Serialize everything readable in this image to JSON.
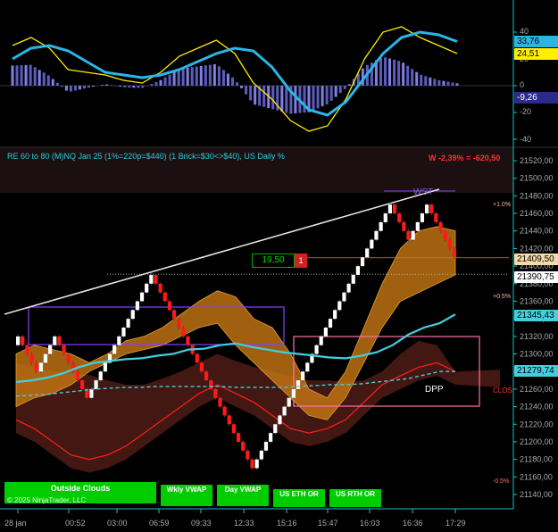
{
  "oscillator": {
    "tick_labels": [
      "40",
      "20",
      "0",
      "-20",
      "-40"
    ],
    "tag_blue": "33,76",
    "tag_yellow": "24,51",
    "tag_purple": "-9,26",
    "colors": {
      "fast": "#ffee00",
      "slow": "#29b6e6",
      "histogram": "#5c5cc0",
      "histogram_highlight": "#8080e0"
    }
  },
  "header": {
    "title": "RE 60 to 80 (M)NQ Jan 25 (1%=220p=$440) (1 Brick=$30<>$40), US Daily %",
    "pnl": "W -2,39% = -620,50"
  },
  "price_axis": {
    "ticks": [
      "21520,00",
      "21500,00",
      "21480,00",
      "21460,00",
      "21440,00",
      "21420,00",
      "21400,00",
      "21380,00",
      "21360,00",
      "21340,00",
      "21320,00",
      "21300,00",
      "21280,00",
      "21260,00",
      "21240,00",
      "21220,00",
      "21200,00",
      "21180,00",
      "21160,00",
      "21140,00"
    ],
    "tags": {
      "last_price": "21409,50",
      "dotted_level": "21390,75",
      "cyan_vwap": "21345,43",
      "cyan_dashed": "21279,74"
    }
  },
  "time_axis": [
    "28 jan",
    "00:52",
    "03:00",
    "06:59",
    "09:33",
    "12:33",
    "15:16",
    "15:47",
    "16:03",
    "16:36",
    "17:29"
  ],
  "annotations": {
    "wst": "WST",
    "dpp": "DPP",
    "pct_plus1": "+1.0%",
    "pct_plus05": "+0.5%",
    "pct_minus05": "-0.5%",
    "clos": "CLOS",
    "position_value": "19,50",
    "position_qty": "1"
  },
  "buttons": {
    "outside_clouds": "Outside Clouds",
    "wkly_vwap": "Wkly VWAP",
    "day_vwap": "Day VWAP",
    "us_eth_or": "US ETH OR",
    "us_rth_or": "US RTH OR"
  },
  "copyright": "© 2025 NinjaTrader, LLC",
  "colors": {
    "up_brick": "#ffffff",
    "down_brick": "#ff1a1a",
    "cloud": "#c87814",
    "dark_cloud": "#4a1a14",
    "vwap": "#40d0e0",
    "button": "#00cc00"
  },
  "chart_data": {
    "type": "renko",
    "brick_size": 10,
    "bricks": [
      [
        21310,
        21320
      ],
      [
        21320,
        21310
      ],
      [
        21310,
        21300
      ],
      [
        21300,
        21290
      ],
      [
        21290,
        21280
      ],
      [
        21280,
        21290
      ],
      [
        21290,
        21300
      ],
      [
        21300,
        21310
      ],
      [
        21310,
        21320
      ],
      [
        21320,
        21310
      ],
      [
        21310,
        21300
      ],
      [
        21300,
        21290
      ],
      [
        21290,
        21280
      ],
      [
        21280,
        21270
      ],
      [
        21270,
        21260
      ],
      [
        21260,
        21250
      ],
      [
        21250,
        21260
      ],
      [
        21260,
        21270
      ],
      [
        21270,
        21280
      ],
      [
        21280,
        21290
      ],
      [
        21290,
        21300
      ],
      [
        21300,
        21310
      ],
      [
        21310,
        21320
      ],
      [
        21320,
        21330
      ],
      [
        21330,
        21340
      ],
      [
        21340,
        21350
      ],
      [
        21350,
        21360
      ],
      [
        21360,
        21370
      ],
      [
        21370,
        21380
      ],
      [
        21380,
        21390
      ],
      [
        21390,
        21380
      ],
      [
        21380,
        21370
      ],
      [
        21370,
        21360
      ],
      [
        21360,
        21350
      ],
      [
        21350,
        21340
      ],
      [
        21340,
        21330
      ],
      [
        21330,
        21320
      ],
      [
        21320,
        21310
      ],
      [
        21310,
        21300
      ],
      [
        21300,
        21290
      ],
      [
        21290,
        21280
      ],
      [
        21280,
        21270
      ],
      [
        21270,
        21260
      ],
      [
        21260,
        21250
      ],
      [
        21250,
        21240
      ],
      [
        21240,
        21230
      ],
      [
        21230,
        21220
      ],
      [
        21220,
        21210
      ],
      [
        21210,
        21200
      ],
      [
        21200,
        21190
      ],
      [
        21190,
        21180
      ],
      [
        21180,
        21170
      ],
      [
        21170,
        21180
      ],
      [
        21180,
        21190
      ],
      [
        21190,
        21200
      ],
      [
        21200,
        21210
      ],
      [
        21210,
        21220
      ],
      [
        21220,
        21230
      ],
      [
        21230,
        21240
      ],
      [
        21240,
        21250
      ],
      [
        21250,
        21260
      ],
      [
        21260,
        21270
      ],
      [
        21270,
        21280
      ],
      [
        21280,
        21290
      ],
      [
        21290,
        21300
      ],
      [
        21300,
        21310
      ],
      [
        21310,
        21320
      ],
      [
        21320,
        21330
      ],
      [
        21330,
        21340
      ],
      [
        21340,
        21350
      ],
      [
        21350,
        21360
      ],
      [
        21360,
        21370
      ],
      [
        21370,
        21380
      ],
      [
        21380,
        21390
      ],
      [
        21390,
        21400
      ],
      [
        21400,
        21410
      ],
      [
        21410,
        21420
      ],
      [
        21420,
        21430
      ],
      [
        21430,
        21440
      ],
      [
        21440,
        21450
      ],
      [
        21450,
        21460
      ],
      [
        21460,
        21470
      ],
      [
        21470,
        21460
      ],
      [
        21460,
        21450
      ],
      [
        21450,
        21440
      ],
      [
        21440,
        21430
      ],
      [
        21430,
        21440
      ],
      [
        21440,
        21450
      ],
      [
        21450,
        21460
      ],
      [
        21460,
        21470
      ],
      [
        21470,
        21460
      ],
      [
        21460,
        21450
      ],
      [
        21450,
        21440
      ],
      [
        21440,
        21430
      ],
      [
        21430,
        21420
      ],
      [
        21420,
        21410
      ]
    ],
    "vwap": [
      21268,
      21270,
      21273,
      21278,
      21285,
      21290,
      21292,
      21294,
      21295,
      21298,
      21300,
      21305,
      21306,
      21310,
      21312,
      21308,
      21305,
      21302,
      21300,
      21298,
      21296,
      21295,
      21298,
      21302,
      21310,
      21322,
      21330,
      21335,
      21345
    ],
    "dashed_vwap": [
      21252,
      21253,
      21254,
      21256,
      21258,
      21260,
      21261,
      21262,
      21262,
      21263,
      21263,
      21263,
      21263,
      21263,
      21262,
      21262,
      21262,
      21262,
      21263,
      21264,
      21265,
      21265,
      21266,
      21268,
      21270,
      21272,
      21276,
      21280,
      21280
    ],
    "lines": {
      "white_trend": {
        "from": [
          0,
          21355
        ],
        "to": [
          1,
          21485
        ]
      },
      "dotted_level": 21390.75,
      "last_price": 21409.5
    },
    "ylim": [
      21130,
      21530
    ]
  }
}
